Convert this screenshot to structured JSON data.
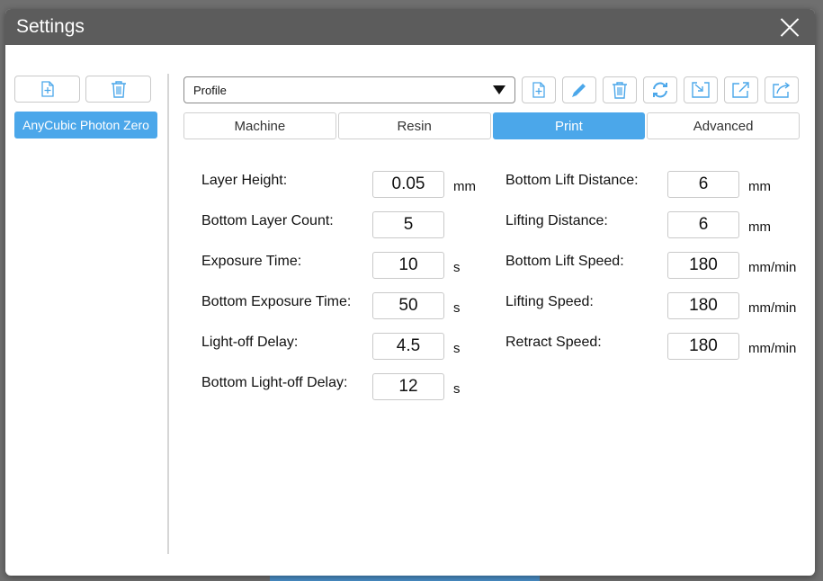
{
  "window": {
    "title": "Settings"
  },
  "machines": {
    "items": [
      {
        "label": "AnyCubic Photon Zero"
      }
    ]
  },
  "profile": {
    "selected": "Profile"
  },
  "tabs": [
    {
      "label": "Machine"
    },
    {
      "label": "Resin"
    },
    {
      "label": "Print"
    },
    {
      "label": "Advanced"
    }
  ],
  "active_tab": "Print",
  "params_left": [
    {
      "label": "Layer Height:",
      "value": "0.05",
      "unit": "mm"
    },
    {
      "label": "Bottom Layer Count:",
      "value": "5",
      "unit": ""
    },
    {
      "label": "Exposure Time:",
      "value": "10",
      "unit": "s"
    },
    {
      "label": "Bottom Exposure Time:",
      "value": "50",
      "unit": "s"
    },
    {
      "label": "Light-off Delay:",
      "value": "4.5",
      "unit": "s"
    },
    {
      "label": "Bottom Light-off Delay:",
      "value": "12",
      "unit": "s"
    }
  ],
  "params_right": [
    {
      "label": "Bottom Lift Distance:",
      "value": "6",
      "unit": "mm"
    },
    {
      "label": "Lifting Distance:",
      "value": "6",
      "unit": "mm"
    },
    {
      "label": "Bottom Lift Speed:",
      "value": "180",
      "unit": "mm/min"
    },
    {
      "label": "Lifting Speed:",
      "value": "180",
      "unit": "mm/min"
    },
    {
      "label": "Retract Speed:",
      "value": "180",
      "unit": "mm/min"
    }
  ],
  "icons": {
    "new": "file-plus-icon",
    "delete": "trash-icon",
    "edit": "pencil-icon",
    "refresh": "refresh-icon",
    "import": "import-icon",
    "export": "export-icon",
    "share": "share-icon",
    "close": "close-icon"
  },
  "colors": {
    "accent": "#4ba7ea",
    "titlebar": "#5c5c5c"
  }
}
